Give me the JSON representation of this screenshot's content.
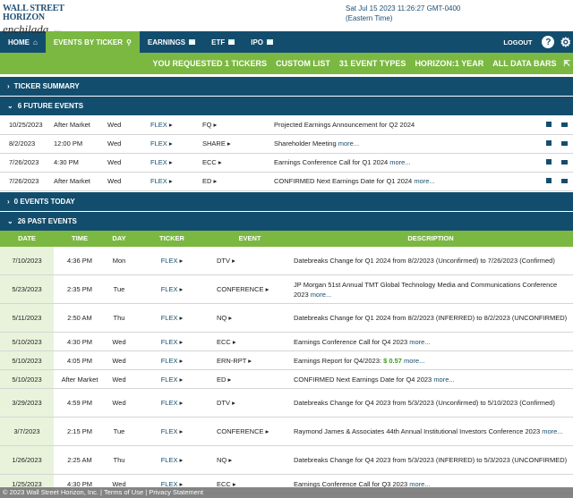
{
  "header": {
    "logo_line1": "WALL STREET HORIZON",
    "logo_line2": "enchilada",
    "logo_tmx": "a TMX company",
    "datetime": "Sat Jul 15 2023 11:26:27 GMT-0400",
    "timezone": "(Eastern Time)"
  },
  "nav": {
    "home": "HOME",
    "events_by_ticker": "EVENTS BY TICKER",
    "earnings": "EARNINGS",
    "etf": "ETF",
    "ipo": "IPO",
    "logout": "LOGOUT",
    "help": "?"
  },
  "filters": {
    "requested": "YOU REQUESTED 1 TICKERS",
    "custom_list": "CUSTOM LIST",
    "event_types": "31 EVENT TYPES",
    "horizon": "HORIZON:1 YEAR",
    "data_bars": "ALL DATA BARS"
  },
  "sections": {
    "ticker_summary": "TICKER SUMMARY",
    "future_events": "6 FUTURE EVENTS",
    "today_events": "0 EVENTS TODAY",
    "past_events": "26 PAST EVENTS"
  },
  "future_rows": [
    {
      "date": "10/25/2023",
      "time": "After Market",
      "day": "Wed",
      "ticker": "FLEX",
      "event": "FQ",
      "desc": "Projected Earnings Announcement for Q2 2024",
      "more": ""
    },
    {
      "date": "8/2/2023",
      "time": "12:00 PM",
      "day": "Wed",
      "ticker": "FLEX",
      "event": "SHARE",
      "desc": "Shareholder Meeting",
      "more": "more..."
    },
    {
      "date": "7/26/2023",
      "time": "4:30 PM",
      "day": "Wed",
      "ticker": "FLEX",
      "event": "ECC",
      "desc": "Earnings Conference Call for Q1 2024",
      "more": "more..."
    },
    {
      "date": "7/26/2023",
      "time": "After Market",
      "day": "Wed",
      "ticker": "FLEX",
      "event": "ED",
      "desc": "CONFIRMED Next Earnings Date for Q1 2024",
      "more": "more..."
    }
  ],
  "past_headers": {
    "date": "DATE",
    "time": "TIME",
    "day": "DAY",
    "ticker": "TICKER",
    "event": "EVENT",
    "description": "DESCRIPTION"
  },
  "past_rows": [
    {
      "date": "7/10/2023",
      "time": "4:36 PM",
      "day": "Mon",
      "ticker": "FLEX",
      "event": "DTV",
      "desc": "Datebreaks Change for Q1 2024 from 8/2/2023 (Unconfirmed) to 7/26/2023 (Confirmed)",
      "more": ""
    },
    {
      "date": "5/23/2023",
      "time": "2:35 PM",
      "day": "Tue",
      "ticker": "FLEX",
      "event": "CONFERENCE",
      "desc": "JP Morgan 51st Annual TMT Global Technology Media and Communications Conference 2023",
      "more": "more..."
    },
    {
      "date": "5/11/2023",
      "time": "2:50 AM",
      "day": "Thu",
      "ticker": "FLEX",
      "event": "NQ",
      "desc": "Datebreaks Change for Q1 2024 from 8/2/2023 (INFERRED) to 8/2/2023 (UNCONFIRMED)",
      "more": ""
    },
    {
      "date": "5/10/2023",
      "time": "4:30 PM",
      "day": "Wed",
      "ticker": "FLEX",
      "event": "ECC",
      "desc": "Earnings Conference Call for Q4 2023",
      "more": "more..."
    },
    {
      "date": "5/10/2023",
      "time": "4:05 PM",
      "day": "Wed",
      "ticker": "FLEX",
      "event": "ERN-RPT",
      "desc": "Earnings Report for Q4/2023:",
      "value": "$ 0.57",
      "more": "more..."
    },
    {
      "date": "5/10/2023",
      "time": "After Market",
      "day": "Wed",
      "ticker": "FLEX",
      "event": "ED",
      "desc": "CONFIRMED Next Earnings Date for Q4 2023",
      "more": "more..."
    },
    {
      "date": "3/29/2023",
      "time": "4:59 PM",
      "day": "Wed",
      "ticker": "FLEX",
      "event": "DTV",
      "desc": "Datebreaks Change for Q4 2023 from 5/3/2023 (Unconfirmed) to 5/10/2023 (Confirmed)",
      "more": ""
    },
    {
      "date": "3/7/2023",
      "time": "2:15 PM",
      "day": "Tue",
      "ticker": "FLEX",
      "event": "CONFERENCE",
      "desc": "Raymond James & Associates 44th Annual Institutional Investors Conference 2023",
      "more": "more..."
    },
    {
      "date": "1/26/2023",
      "time": "2:25 AM",
      "day": "Thu",
      "ticker": "FLEX",
      "event": "NQ",
      "desc": "Datebreaks Change for Q4 2023 from 5/3/2023 (INFERRED) to 5/3/2023 (UNCONFIRMED)",
      "more": ""
    },
    {
      "date": "1/25/2023",
      "time": "4:30 PM",
      "day": "Wed",
      "ticker": "FLEX",
      "event": "ECC",
      "desc": "Earnings Conference Call for Q3 2023",
      "more": "more..."
    }
  ],
  "footer": {
    "text": "© 2023 Wall Street Horizon, Inc. | Terms of Use | Privacy Statement"
  }
}
